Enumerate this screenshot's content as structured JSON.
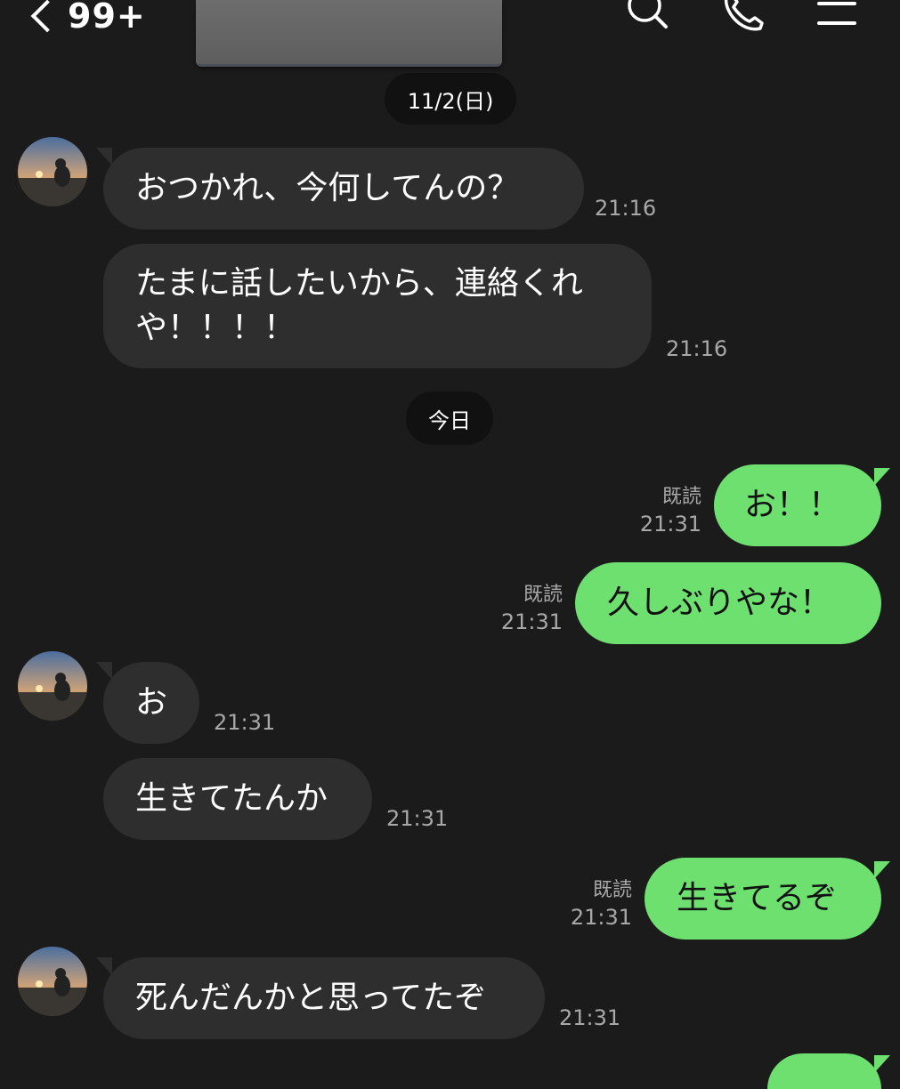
{
  "header": {
    "back_count": "99+",
    "icons": [
      "search-icon",
      "phone-icon",
      "menu-icon"
    ]
  },
  "date_separators": [
    "11/2(日)",
    "今日"
  ],
  "messages": [
    {
      "side": "left",
      "text": "おつかれ、今何してんの？",
      "time": "21:16"
    },
    {
      "side": "left",
      "text": "たまに話したいから、連絡くれや！！！！",
      "time": "21:16"
    },
    {
      "side": "right",
      "text": "お！！",
      "read": "既読",
      "time": "21:31"
    },
    {
      "side": "right",
      "text": "久しぶりやな！",
      "read": "既読",
      "time": "21:31"
    },
    {
      "side": "left",
      "text": "お",
      "time": "21:31"
    },
    {
      "side": "left",
      "text": "生きてたんか",
      "time": "21:31"
    },
    {
      "side": "right",
      "text": "生きてるぞ",
      "read": "既読",
      "time": "21:31"
    },
    {
      "side": "left",
      "text": "死んだんかと思ってたぞ",
      "time": "21:31"
    }
  ],
  "colors": {
    "background": "#1b1b1b",
    "incoming_bubble": "#2e2e2e",
    "outgoing_bubble": "#6de070",
    "meta_text": "#a8a8a8"
  }
}
